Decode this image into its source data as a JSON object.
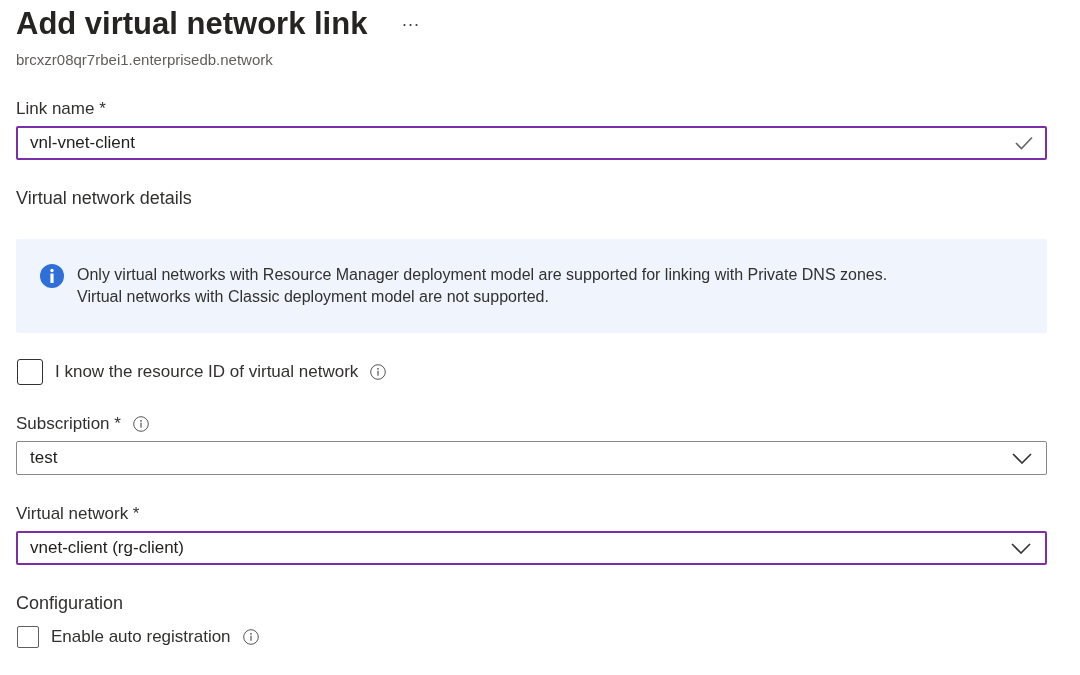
{
  "header": {
    "title": "Add virtual network link",
    "more": "···",
    "subtitle": "brcxzr08qr7rbei1.enterprisedb.network"
  },
  "items": [
    {
      "kind": "field",
      "label": "Link name *",
      "value": "vnl-vnet-client",
      "focused": true,
      "valid": true
    },
    {
      "kind": "heading",
      "text": "Virtual network details"
    },
    {
      "kind": "notice",
      "text": "Only virtual networks with Resource Manager deployment model are supported for linking with Private DNS zones.\nVirtual networks with Classic deployment model are not supported."
    },
    {
      "kind": "checkbox",
      "label": "I know the resource ID of virtual network",
      "checked": false,
      "info": true
    },
    {
      "kind": "dropdown",
      "label": "Subscription *",
      "info": true,
      "value": "test",
      "focused": false
    },
    {
      "kind": "dropdown",
      "label": "Virtual network *",
      "value": "vnet-client (rg-client)",
      "focused": true
    },
    {
      "kind": "heading",
      "text": "Configuration"
    },
    {
      "kind": "checkbox",
      "label": "Enable auto registration",
      "checked": false,
      "info": true
    }
  ]
}
